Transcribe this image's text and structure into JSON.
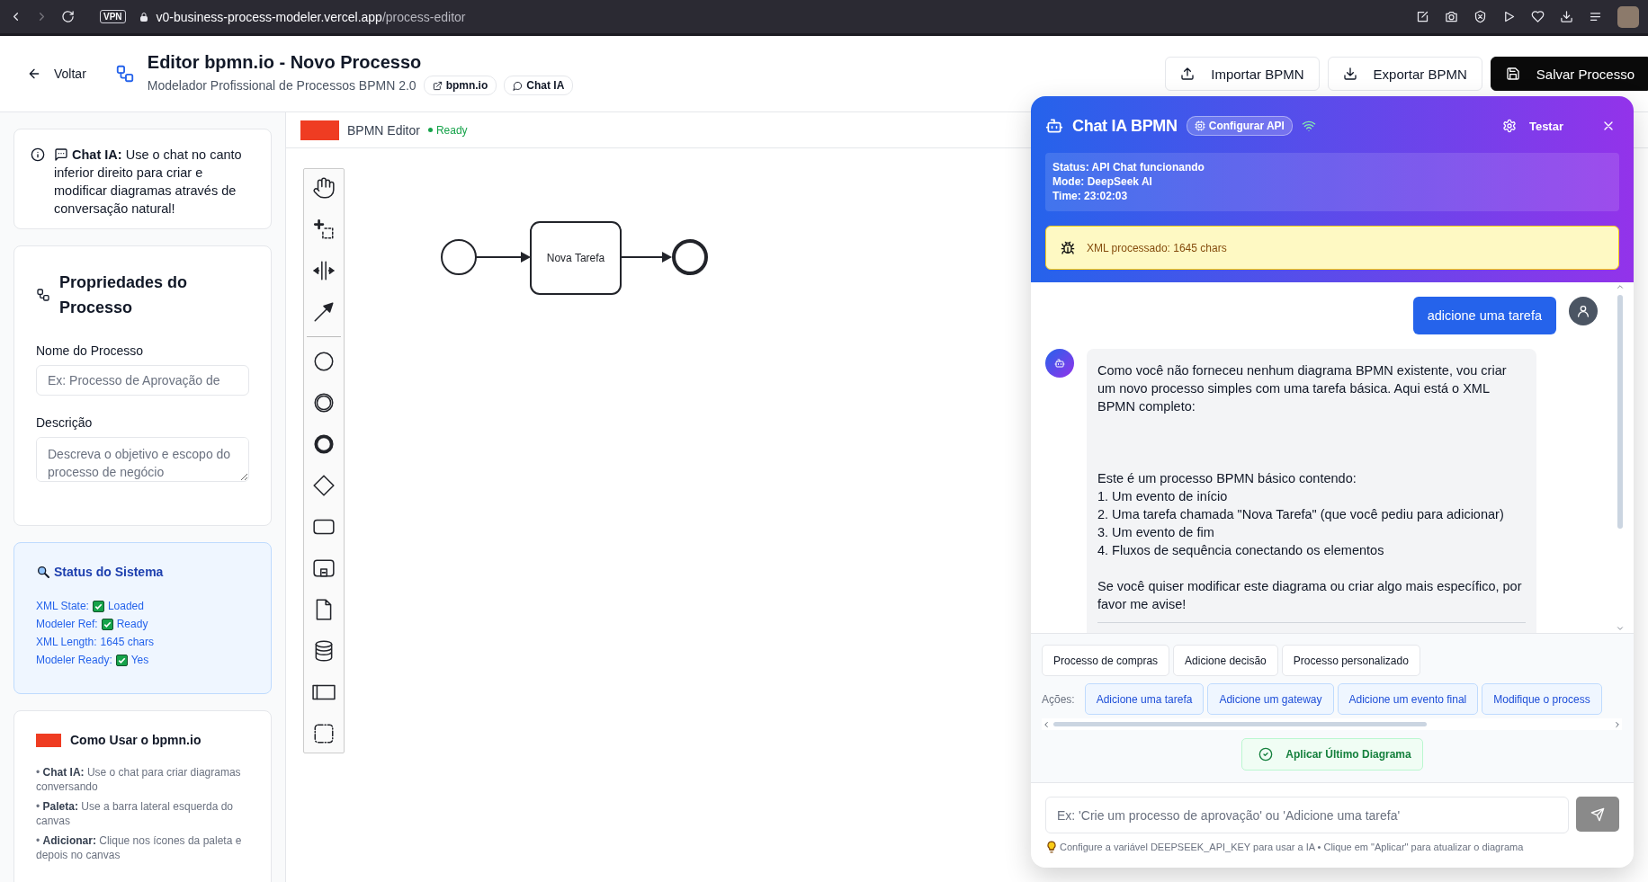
{
  "browser": {
    "vpn": "VPN",
    "url_host": "v0-business-process-modeler.vercel.app",
    "url_path": "/process-editor"
  },
  "header": {
    "back": "Voltar",
    "title": "Editor bpmn.io - Novo Processo",
    "subtitle": "Modelador Profissional de Processos BPMN 2.0",
    "chips": [
      {
        "label": "bpmn.io",
        "kind": "external"
      },
      {
        "label": "Chat IA",
        "kind": "chat"
      }
    ],
    "buttons": [
      {
        "label": "Importar BPMN",
        "kind": "upload",
        "primary": false
      },
      {
        "label": "Exportar BPMN",
        "kind": "download",
        "primary": false
      },
      {
        "label": "Salvar Processo",
        "kind": "save",
        "primary": true
      }
    ]
  },
  "sidebar": {
    "tip": "**Chat IA:** Use o chat no canto inferior direito para criar e modificar diagramas através de conversação natural!",
    "properties": {
      "title": "Propriedades do Processo",
      "fields": [
        {
          "label": "Nome do Processo",
          "placeholder": "Ex: Processo de Aprovação de",
          "kind": "input"
        },
        {
          "label": "Descrição",
          "placeholder": "Descreva o objetivo e escopo do processo de negócio",
          "kind": "textarea"
        }
      ]
    },
    "status": {
      "title": "Status do Sistema",
      "lines": [
        {
          "label": "XML State:",
          "value": "Loaded",
          "checked": true
        },
        {
          "label": "Modeler Ref:",
          "value": "Ready",
          "checked": true
        },
        {
          "label": "XML Length:",
          "value": "1645 chars",
          "checked": false
        },
        {
          "label": "Modeler Ready:",
          "value": "Yes",
          "checked": true
        }
      ]
    },
    "guide": {
      "title": "Como Usar o bpmn.io",
      "items": [
        "• **Chat IA:** Use o chat para criar diagramas conversando",
        "• **Paleta:** Use a barra lateral esquerda do canvas",
        "• **Adicionar:** Clique nos ícones da paleta e depois no canvas"
      ]
    }
  },
  "editor": {
    "title": "BPMN Editor",
    "status": "Ready",
    "ready": true,
    "task": "Nova Tarefa"
  },
  "chat": {
    "title": "Chat IA BPMN",
    "badge": "Configurar API",
    "test": "Testar",
    "status_lines": [
      "Status: API Chat funcionando",
      "Mode: DeepSeek AI",
      "Time: 23:02:03"
    ],
    "notice": "XML processado: 1645 chars",
    "messages": [
      {
        "kind": "user",
        "text": "adicione uma tarefa"
      },
      {
        "kind": "assistant",
        "text": "Como você não forneceu nenhum diagrama BPMN existente, vou criar um novo processo simples com uma tarefa básica. Aqui está o XML BPMN completo:\n\n\n\nEste é um processo BPMN básico contendo:\n1. Um evento de início\n2. Uma tarefa chamada \"Nova Tarefa\" (que você pediu para adicionar)\n3. Um evento de fim\n4. Fluxos de sequência conectando os elementos\n\nSe você quiser modificar este diagrama ou criar algo mais específico, por favor me avise!"
      }
    ],
    "suggestions": [
      "Processo de compras",
      "Adicione decisão",
      "Processo personalizado"
    ],
    "actions_label": "Ações:",
    "actions": [
      "Adicione uma tarefa",
      "Adicione um gateway",
      "Adicione um evento final",
      "Modifique o process"
    ],
    "apply": "Aplicar Último Diagrama",
    "input": {
      "placeholder": "Ex: 'Crie um processo de aprovação' ou 'Adicione uma tarefa'"
    },
    "send": {
      "disabled": true
    },
    "hint": "Configure a variável DEEPSEEK_API_KEY para usar a IA • Clique em \"Aplicar\" para atualizar o diagrama"
  }
}
